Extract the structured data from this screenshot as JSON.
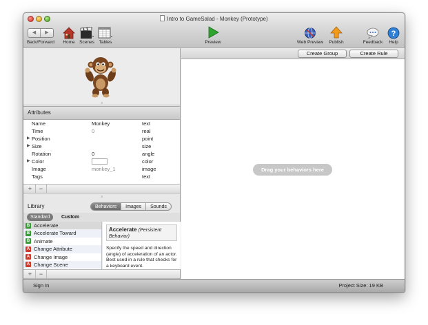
{
  "window": {
    "title": "Intro to GameSalad - Monkey (Prototype)"
  },
  "toolbar": {
    "back_forward_label": "Back/Forward",
    "back_glyph": "◀",
    "forward_glyph": "▶",
    "home_label": "Home",
    "scenes_label": "Scenes",
    "tables_label": "Tables",
    "preview_label": "Preview",
    "web_preview_label": "Web Preview",
    "publish_label": "Publish",
    "feedback_label": "Feedback",
    "help_label": "Help",
    "icons": [
      "home-icon",
      "scenes-icon",
      "tables-icon",
      "preview-icon",
      "web-preview-icon",
      "publish-icon",
      "feedback-icon",
      "help-icon"
    ]
  },
  "attributes": {
    "header": "Attributes",
    "rows": [
      {
        "name": "Name",
        "value": "Monkey",
        "type": "text",
        "expandable": false,
        "dim": false
      },
      {
        "name": "Time",
        "value": "0",
        "type": "real",
        "expandable": false,
        "dim": true
      },
      {
        "name": "Position",
        "value": "",
        "type": "point",
        "expandable": true,
        "dim": false
      },
      {
        "name": "Size",
        "value": "",
        "type": "size",
        "expandable": true,
        "dim": false
      },
      {
        "name": "Rotation",
        "value": "0",
        "type": "angle",
        "expandable": false,
        "dim": false
      },
      {
        "name": "Color",
        "value": "",
        "type": "color",
        "expandable": true,
        "dim": false
      },
      {
        "name": "Image",
        "value": "monkey_1",
        "type": "image",
        "expandable": false,
        "dim": true
      },
      {
        "name": "Tags",
        "value": "",
        "type": "text",
        "expandable": false,
        "dim": false
      }
    ],
    "add_label": "+",
    "remove_label": "−"
  },
  "library": {
    "title": "Library",
    "tabs": [
      "Behaviors",
      "Images",
      "Sounds"
    ],
    "active_tab": "Behaviors",
    "filters": [
      "Standard",
      "Custom"
    ],
    "active_filter": "Standard",
    "behaviors": [
      {
        "label": "Accelerate",
        "badge": "B",
        "badge_color": "#3a9a3a"
      },
      {
        "label": "Accelerate Toward",
        "badge": "B",
        "badge_color": "#3a9a3a"
      },
      {
        "label": "Animate",
        "badge": "B",
        "badge_color": "#3a9a3a"
      },
      {
        "label": "Change Attribute",
        "badge": "A",
        "badge_color": "#d03a2a"
      },
      {
        "label": "Change Image",
        "badge": "A",
        "badge_color": "#d03a2a"
      },
      {
        "label": "Change Scene",
        "badge": "A",
        "badge_color": "#d03a2a"
      }
    ],
    "description": {
      "title": "Accelerate",
      "subtitle": "(Persistent Behavior)",
      "body": "Specify the speed and direction (angle) of acceleration of an actor. Best used in a rule that checks for a keyboard event."
    },
    "add_label": "+",
    "remove_label": "−"
  },
  "editor": {
    "create_group_label": "Create Group",
    "create_rule_label": "Create Rule",
    "drag_hint": "Drag your behaviors here"
  },
  "status": {
    "sign_in": "Sign In",
    "project_size": "Project Size: 19 KB"
  },
  "colors": {
    "window_bg": "#ececec",
    "drag_hint_bg": "#c7c7c7",
    "preview_green": "#2fa52f",
    "publish_orange": "#f39a1a",
    "help_blue": "#2f7fd6"
  }
}
